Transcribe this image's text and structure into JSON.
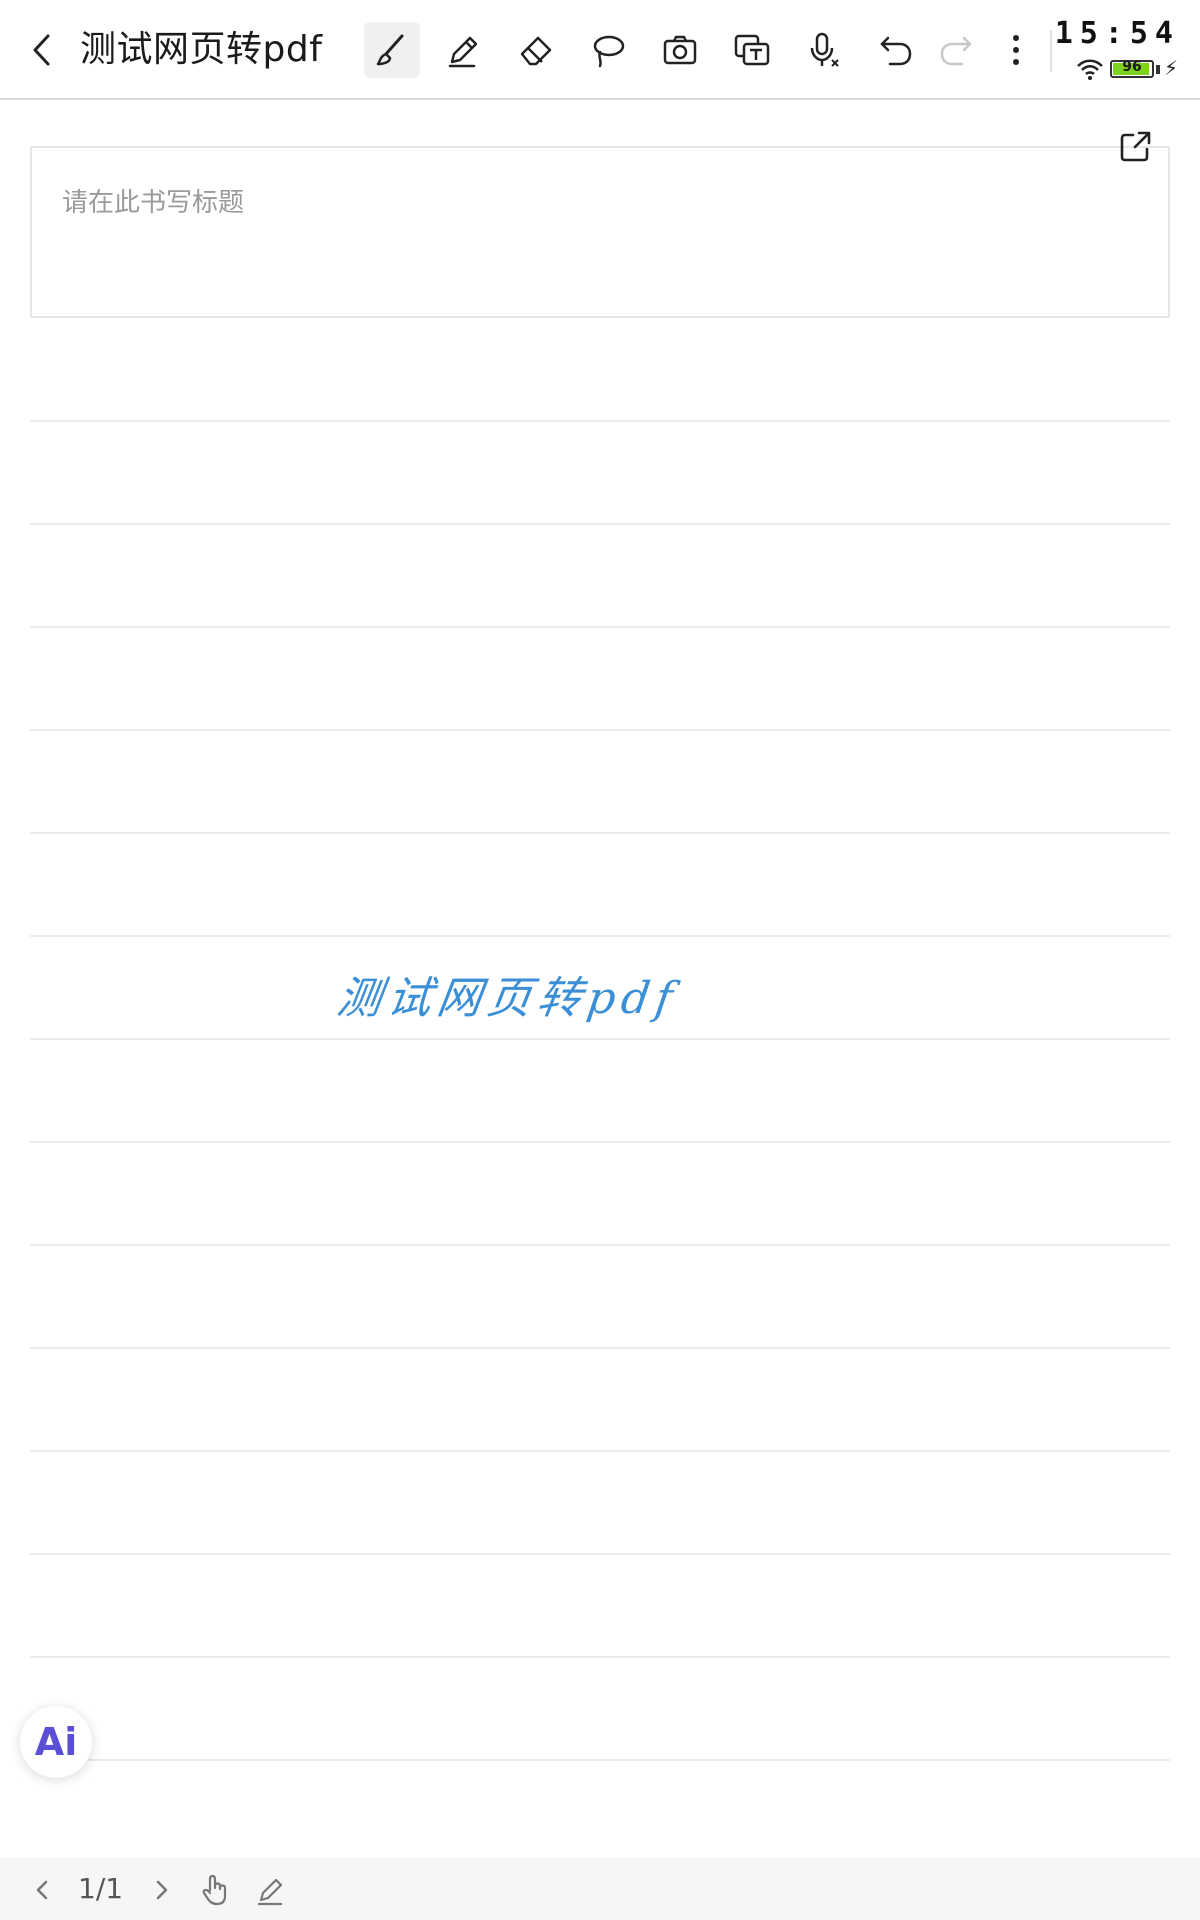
{
  "header": {
    "title": "测试网页转pdf",
    "tools": [
      {
        "name": "brush-icon",
        "active": true
      },
      {
        "name": "pencil-icon",
        "active": false
      },
      {
        "name": "eraser-icon",
        "active": false
      },
      {
        "name": "lasso-icon",
        "active": false
      },
      {
        "name": "camera-icon",
        "active": false
      },
      {
        "name": "text-recognize-icon",
        "active": false
      },
      {
        "name": "voice-to-text-icon",
        "active": false
      },
      {
        "name": "undo-icon",
        "active": false
      },
      {
        "name": "redo-icon",
        "active": false
      },
      {
        "name": "more-icon",
        "active": false
      }
    ]
  },
  "status": {
    "time": "15:54",
    "battery": 96,
    "charging": true
  },
  "note": {
    "title_placeholder": "请在此书写标题",
    "handwritten_text": "测试网页转pdf"
  },
  "ai_button": {
    "label": "Ai"
  },
  "footer": {
    "page_indicator": "1/1"
  },
  "colors": {
    "handwriting": "#3a8fd6",
    "battery_fill": "#7ed321",
    "ai_accent": "#5b4fd6"
  }
}
